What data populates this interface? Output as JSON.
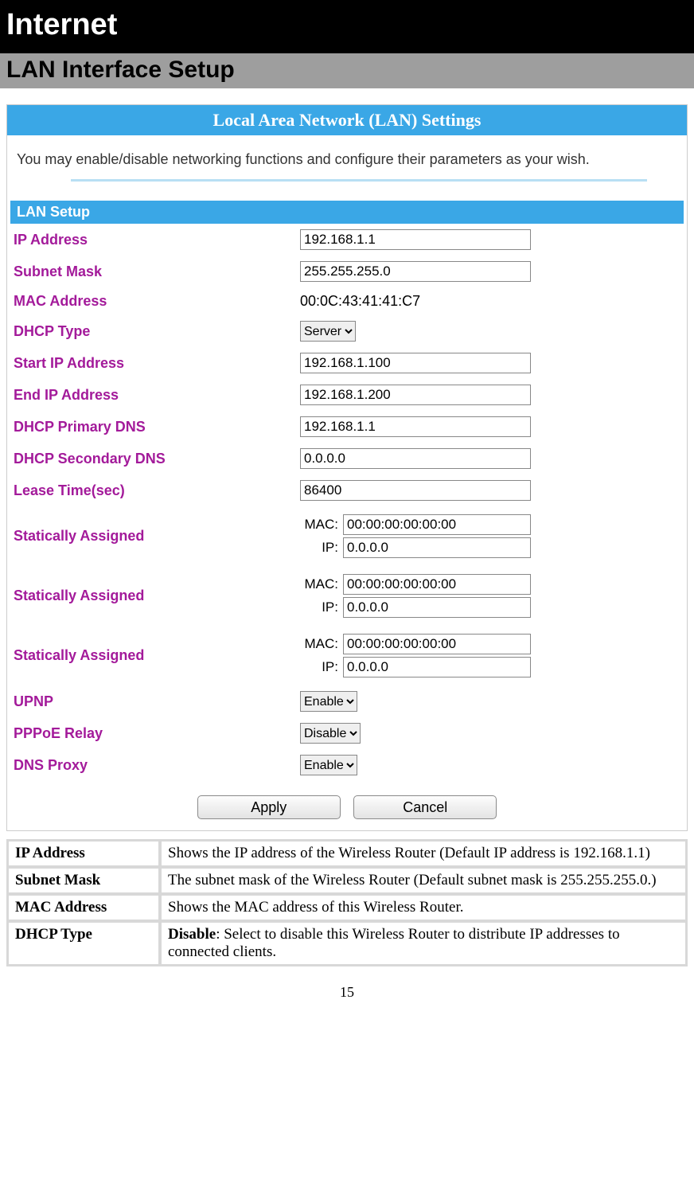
{
  "header": {
    "title_main": "Internet",
    "title_sub": "LAN Interface Setup"
  },
  "panel": {
    "title": "Local Area Network (LAN) Settings",
    "desc": "You may enable/disable networking functions and configure their parameters as your wish.",
    "group_title": "LAN Setup"
  },
  "form": {
    "ip_address": {
      "label": "IP Address",
      "value": "192.168.1.1"
    },
    "subnet_mask": {
      "label": "Subnet Mask",
      "value": "255.255.255.0"
    },
    "mac_address": {
      "label": "MAC Address",
      "value": "00:0C:43:41:41:C7"
    },
    "dhcp_type": {
      "label": "DHCP Type",
      "value": "Server"
    },
    "start_ip": {
      "label": "Start IP Address",
      "value": "192.168.1.100"
    },
    "end_ip": {
      "label": "End IP Address",
      "value": "192.168.1.200"
    },
    "primary_dns": {
      "label": "DHCP Primary DNS",
      "value": "192.168.1.1"
    },
    "secondary_dns": {
      "label": "DHCP Secondary DNS",
      "value": "0.0.0.0"
    },
    "lease_time": {
      "label": "Lease Time(sec)",
      "value": "86400"
    },
    "static_label": "Statically Assigned",
    "mac_lbl": "MAC:",
    "ip_lbl": "IP:",
    "static1": {
      "mac": "00:00:00:00:00:00",
      "ip": "0.0.0.0"
    },
    "static2": {
      "mac": "00:00:00:00:00:00",
      "ip": "0.0.0.0"
    },
    "static3": {
      "mac": "00:00:00:00:00:00",
      "ip": "0.0.0.0"
    },
    "upnp": {
      "label": "UPNP",
      "value": "Enable"
    },
    "pppoe": {
      "label": "PPPoE Relay",
      "value": "Disable"
    },
    "dns_proxy": {
      "label": "DNS Proxy",
      "value": "Enable"
    }
  },
  "buttons": {
    "apply": "Apply",
    "cancel": "Cancel"
  },
  "desc_rows": [
    {
      "k": "IP Address",
      "v": "Shows the IP address of the Wireless  Router (Default IP address is 192.168.1.1)"
    },
    {
      "k": "Subnet Mask",
      "v": "The subnet mask of the Wireless  Router (Default subnet mask is 255.255.255.0.)"
    },
    {
      "k": "MAC Address",
      "v": "Shows the MAC address of this Wireless  Router."
    },
    {
      "k": "DHCP Type",
      "v_bold": "Disable",
      "v_rest": ": Select to disable this Wireless  Router to distribute IP addresses to connected clients."
    }
  ],
  "page_number": "15"
}
